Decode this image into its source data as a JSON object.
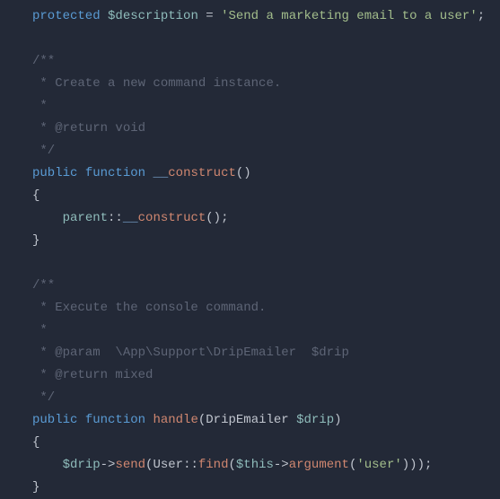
{
  "code": {
    "l1_protected": "protected",
    "l1_var": "$description",
    "l1_eq": " = ",
    "l1_str": "'Send a marketing email to a user'",
    "l1_semi": ";",
    "c1_open": "/**",
    "c1_l1": " * Create a new command instance.",
    "c1_l2": " *",
    "c1_l3": " * @return void",
    "c1_close": " */",
    "m1_pub": "public",
    "m1_sp1": " ",
    "m1_fn": "function",
    "m1_sp2": " ",
    "m1_us": "__",
    "m1_name": "construct",
    "m1_parens": "()",
    "m1_ob": "{",
    "m1_indent": "    ",
    "m1_parent": "parent",
    "m1_dc": "::",
    "m1_us2": "__",
    "m1_con2": "construct",
    "m1_call": "();",
    "m1_cb": "}",
    "c2_open": "/**",
    "c2_l1": " * Execute the console command.",
    "c2_l2": " *",
    "c2_l3": " * @param  \\App\\Support\\DripEmailer  $drip",
    "c2_l4": " * @return mixed",
    "c2_close": " */",
    "m2_pub": "public",
    "m2_sp1": " ",
    "m2_fn": "function",
    "m2_sp2": " ",
    "m2_name": "handle",
    "m2_op": "(",
    "m2_type": "DripEmailer",
    "m2_sp3": " ",
    "m2_param": "$drip",
    "m2_cp": ")",
    "m2_ob": "{",
    "m2_indent": "    ",
    "m2_drip": "$drip",
    "m2_arr1": "->",
    "m2_send": "send",
    "m2_op2": "(",
    "m2_user": "User",
    "m2_dc": "::",
    "m2_find": "find",
    "m2_op3": "(",
    "m2_this": "$this",
    "m2_arr2": "->",
    "m2_arg": "argument",
    "m2_op4": "(",
    "m2_ustr": "'user'",
    "m2_tail": ")));",
    "m2_cb": "}"
  }
}
